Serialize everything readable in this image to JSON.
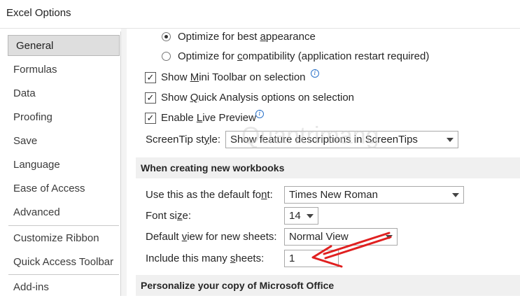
{
  "window": {
    "title": "Excel Options"
  },
  "sidebar": {
    "items": [
      {
        "label": "General"
      },
      {
        "label": "Formulas"
      },
      {
        "label": "Data"
      },
      {
        "label": "Proofing"
      },
      {
        "label": "Save"
      },
      {
        "label": "Language"
      },
      {
        "label": "Ease of Access"
      },
      {
        "label": "Advanced"
      },
      {
        "label": "Customize Ribbon"
      },
      {
        "label": "Quick Access Toolbar"
      },
      {
        "label": "Add-ins"
      }
    ],
    "selected": "General"
  },
  "ui_options": {
    "radio_best_appearance": {
      "pre": "Optimize for best ",
      "u": "a",
      "post": "ppearance",
      "selected": true
    },
    "radio_compatibility": {
      "pre": "Optimize for ",
      "u": "c",
      "post": "ompatibility (application restart required)",
      "selected": false
    },
    "mini_toolbar": {
      "pre": "Show ",
      "u": "M",
      "post": "ini Toolbar on selection",
      "checked": true
    },
    "quick_analysis": {
      "pre": "Show ",
      "u": "Q",
      "post": "uick Analysis options on selection",
      "checked": true
    },
    "live_preview": {
      "pre": "Enable ",
      "u": "L",
      "post": "ive Preview",
      "checked": true
    },
    "screentip": {
      "pre": "ScreenTip st",
      "u": "y",
      "post": "le:",
      "value": "Show feature descriptions in ScreenTips"
    }
  },
  "new_workbooks": {
    "header": "When creating new workbooks",
    "default_font": {
      "pre": "Use this as the default fo",
      "u": "n",
      "post": "t:",
      "value": "Times New Roman"
    },
    "font_size": {
      "pre": "Font si",
      "u": "z",
      "post": "e:",
      "value": "14"
    },
    "default_view": {
      "pre": "Default ",
      "u": "v",
      "post": "iew for new sheets:",
      "value": "Normal View"
    },
    "sheets_count": {
      "pre": "Include this many ",
      "u": "s",
      "post": "heets:",
      "value": "1"
    }
  },
  "personalize": {
    "header": "Personalize your copy of Microsoft Office"
  },
  "watermark": {
    "text": "Quantrimang"
  },
  "colors": {
    "annotation_arrow": "#e02020",
    "selected_nav": "#dedede",
    "info_icon": "#2b72c9"
  },
  "icons": {
    "checked": "checkmark-icon",
    "info": "info-icon",
    "dropdown": "chevron-down-icon"
  }
}
